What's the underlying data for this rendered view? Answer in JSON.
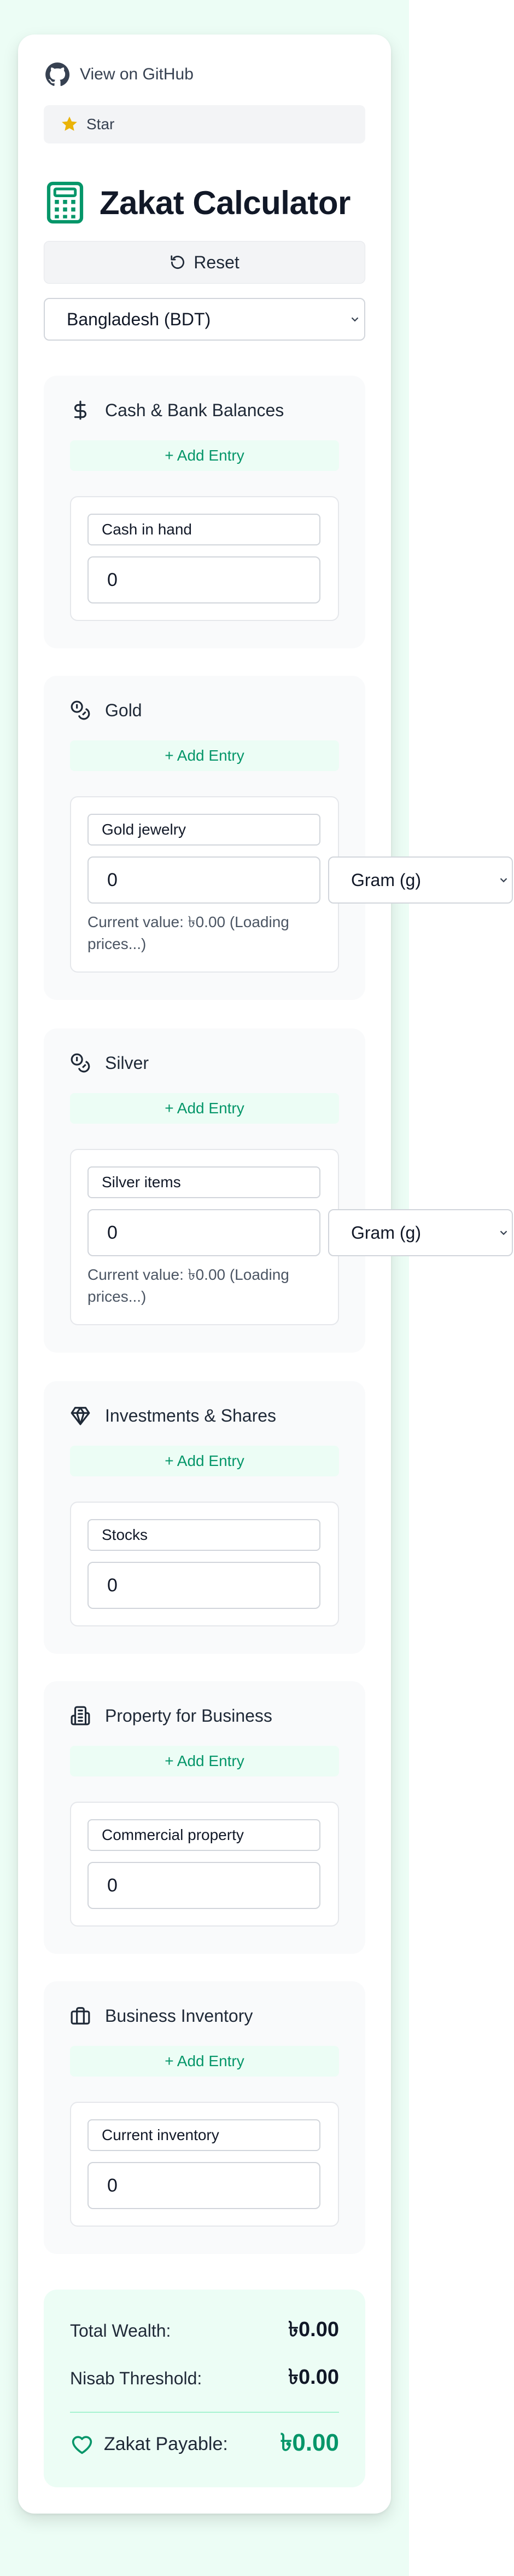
{
  "github": {
    "label": "View on GitHub",
    "icon": "github-icon"
  },
  "star": {
    "label": "Star",
    "icon": "star-icon",
    "icon_color": "#eab308"
  },
  "header": {
    "title": "Zakat Calculator",
    "icon": "calculator-icon",
    "icon_color": "#059669"
  },
  "reset": {
    "label": "Reset",
    "icon": "reset-icon"
  },
  "country": {
    "selected": "Bangladesh (BDT)"
  },
  "add_entry_label": "+ Add Entry",
  "sections": {
    "cash": {
      "title": "Cash & Bank Balances",
      "icon": "dollar-icon",
      "entry_name": "Cash in hand",
      "entry_amount": "0"
    },
    "gold": {
      "title": "Gold",
      "icon": "coins-icon",
      "entry_name": "Gold jewelry",
      "entry_amount": "0",
      "unit": "Gram (g)",
      "value_note": "Current value: ৳0.00 (Loading prices...)"
    },
    "silver": {
      "title": "Silver",
      "icon": "coins-icon",
      "entry_name": "Silver items",
      "entry_amount": "0",
      "unit": "Gram (g)",
      "value_note": "Current value: ৳0.00 (Loading prices...)"
    },
    "investments": {
      "title": "Investments & Shares",
      "icon": "gem-icon",
      "entry_name": "Stocks",
      "entry_amount": "0"
    },
    "property": {
      "title": "Property for Business",
      "icon": "building-icon",
      "entry_name": "Commercial property",
      "entry_amount": "0"
    },
    "inventory": {
      "title": "Business Inventory",
      "icon": "briefcase-icon",
      "entry_name": "Current inventory",
      "entry_amount": "0"
    }
  },
  "summary": {
    "total_wealth_label": "Total Wealth:",
    "total_wealth_value": "৳0.00",
    "nisab_label": "Nisab Threshold:",
    "nisab_value": "৳0.00",
    "zakat_label": "Zakat Payable:",
    "zakat_value": "৳0.00",
    "icon": "heart-icon"
  },
  "colors": {
    "accent": "#059669",
    "accent_light": "#ecfdf5",
    "page_bg": "#ecfdf5"
  }
}
